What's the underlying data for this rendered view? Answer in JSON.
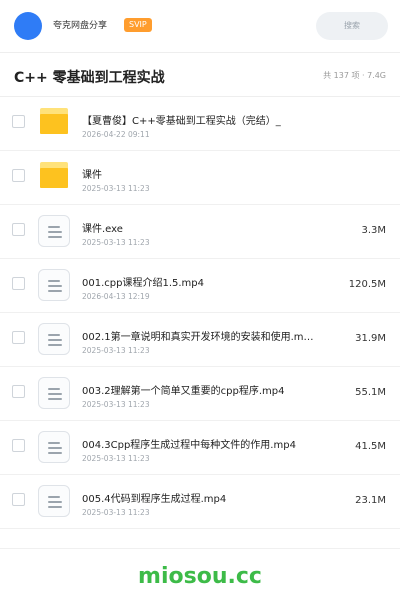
{
  "header": {
    "app_name": "夸克网盘分享",
    "badge": "SVIP",
    "search_placeholder": "搜索"
  },
  "folder": {
    "title": "C++ 零基础到工程实战",
    "summary": "共 137 项 · 7.4G"
  },
  "files": [
    {
      "type": "folder",
      "icon": "folder-icon",
      "name": "【夏曹俊】C++零基础到工程实战（完结）_",
      "date": "2026-04-22 09:11",
      "size": ""
    },
    {
      "type": "folder",
      "icon": "folder-icon",
      "name": "课件",
      "date": "2025-03-13 11:23",
      "size": ""
    },
    {
      "type": "file",
      "icon": "document-icon",
      "name": "课件.exe",
      "date": "2025-03-13 11:23",
      "size": "3.3M"
    },
    {
      "type": "file",
      "icon": "document-icon",
      "name": "001.cpp课程介绍1.5.mp4",
      "date": "2026-04-13 12:19",
      "size": "120.5M"
    },
    {
      "type": "file",
      "icon": "document-icon",
      "name": "002.1第一章说明和真实开发环境的安装和使用.m…",
      "date": "2025-03-13 11:23",
      "size": "31.9M"
    },
    {
      "type": "file",
      "icon": "document-icon",
      "name": "003.2理解第一个简单又重要的cpp程序.mp4",
      "date": "2025-03-13 11:23",
      "size": "55.1M"
    },
    {
      "type": "file",
      "icon": "document-icon",
      "name": "004.3Cpp程序生成过程中每种文件的作用.mp4",
      "date": "2025-03-13 11:23",
      "size": "41.5M"
    },
    {
      "type": "file",
      "icon": "document-icon",
      "name": "005.4代码到程序生成过程.mp4",
      "date": "2025-03-13 11:23",
      "size": "23.1M"
    }
  ],
  "footer": {
    "brand": "miosou.cc"
  },
  "colors": {
    "avatar": "#2f7cf6",
    "badge": "#ff9d2e",
    "folder": "#fdc21f",
    "brand": "#3dbb48"
  }
}
